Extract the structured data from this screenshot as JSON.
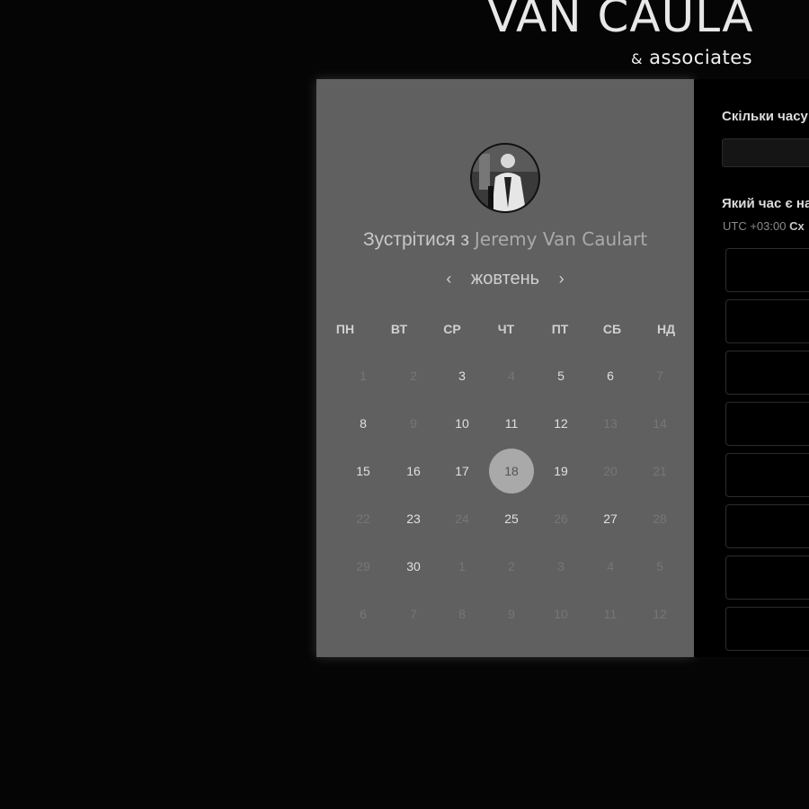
{
  "brand": {
    "name": "VAN CAULA",
    "amp": "&",
    "sub": "associates"
  },
  "scheduler": {
    "meet_prefix": "Зустрітися з",
    "host_name": "Jeremy Van Caulart",
    "month": "жовтень",
    "prev_icon": "‹",
    "next_icon": "›",
    "weekdays": [
      "ПН",
      "ВТ",
      "СР",
      "ЧТ",
      "ПТ",
      "СБ",
      "НД"
    ],
    "days": [
      [
        "1",
        "2",
        "3",
        "4",
        "5",
        "6",
        "7"
      ],
      [
        "8",
        "9",
        "10",
        "11",
        "12",
        "13",
        "14"
      ],
      [
        "15",
        "16",
        "17",
        "18",
        "19",
        "20",
        "21"
      ],
      [
        "22",
        "23",
        "24",
        "25",
        "26",
        "27",
        "28"
      ],
      [
        "29",
        "30",
        "1",
        "2",
        "3",
        "4",
        "5"
      ],
      [
        "6",
        "7",
        "8",
        "9",
        "10",
        "11",
        "12"
      ]
    ],
    "available_days": [
      "3",
      "5",
      "6",
      "8",
      "10",
      "11",
      "12",
      "15",
      "16",
      "17",
      "19",
      "23",
      "25",
      "27",
      "30"
    ],
    "selected_day": "18"
  },
  "booking": {
    "duration_label": "Скільки часу",
    "time_label": "Який час є на",
    "tz_offset": "UTC +03:00",
    "tz_name": "Сх"
  },
  "colors": {
    "card_bg": "#606060",
    "selected": "#a9a9a9"
  }
}
